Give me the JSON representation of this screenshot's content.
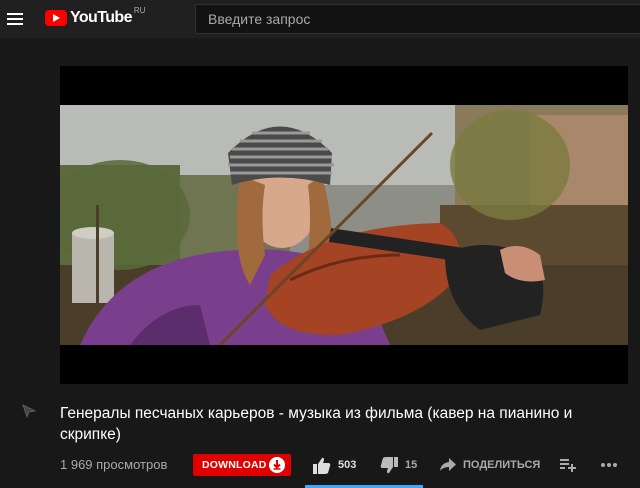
{
  "header": {
    "logo_text": "YouTube",
    "logo_region": "RU",
    "search_placeholder": "Введите запрос"
  },
  "video": {
    "title": "Генералы песчаных карьеров - музыка из фильма (кавер на пианино и скрипке)",
    "views": "1 969 просмотров"
  },
  "actions": {
    "download_label": "DOWNLOAD",
    "likes": "503",
    "dislikes": "15",
    "share_label": "ПОДЕЛИТЬСЯ"
  },
  "colors": {
    "accent_red": "#ff0000",
    "download_red": "#e00000",
    "background": "#181818",
    "header": "#202020",
    "progress_blue": "#3ea6ff"
  },
  "icons": [
    "menu-icon",
    "youtube-logo-icon",
    "pointer-cursor-icon",
    "download-arrow-icon",
    "thumbs-up-icon",
    "thumbs-down-icon",
    "share-icon",
    "add-to-playlist-icon",
    "more-icon"
  ]
}
